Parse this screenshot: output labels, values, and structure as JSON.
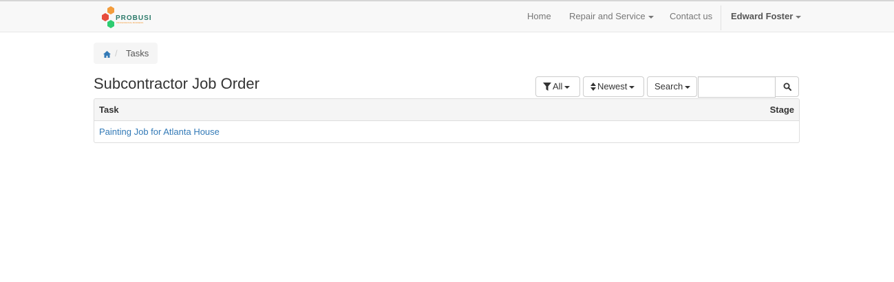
{
  "brand": {
    "name": "PROBUSE",
    "tagline": "PROFESSIONAL BUSINESS",
    "colors": {
      "orange": "#f39c3c",
      "red": "#e74c3c",
      "green": "#2ecc71",
      "text": "#2c7a6a"
    }
  },
  "nav": {
    "home": "Home",
    "repair": "Repair and Service",
    "contact": "Contact us",
    "user": "Edward Foster"
  },
  "breadcrumb": {
    "home_icon": "home-icon",
    "separator": "/",
    "current": "Tasks"
  },
  "page": {
    "title": "Subcontractor Job Order"
  },
  "toolbar": {
    "filter_label": "All",
    "filter_icon": "filter-icon",
    "sort_label": "Newest",
    "sort_icon": "sort-icon",
    "search_menu_label": "Search",
    "search_placeholder": "",
    "search_button_icon": "search-icon"
  },
  "table": {
    "columns": [
      "Task",
      "Stage"
    ],
    "rows": [
      {
        "task": "Painting Job for Atlanta House",
        "stage": ""
      }
    ]
  },
  "colors": {
    "link": "#337ab7",
    "navbar_bg": "#f8f8f8",
    "breadcrumb_bg": "#f5f5f5"
  }
}
